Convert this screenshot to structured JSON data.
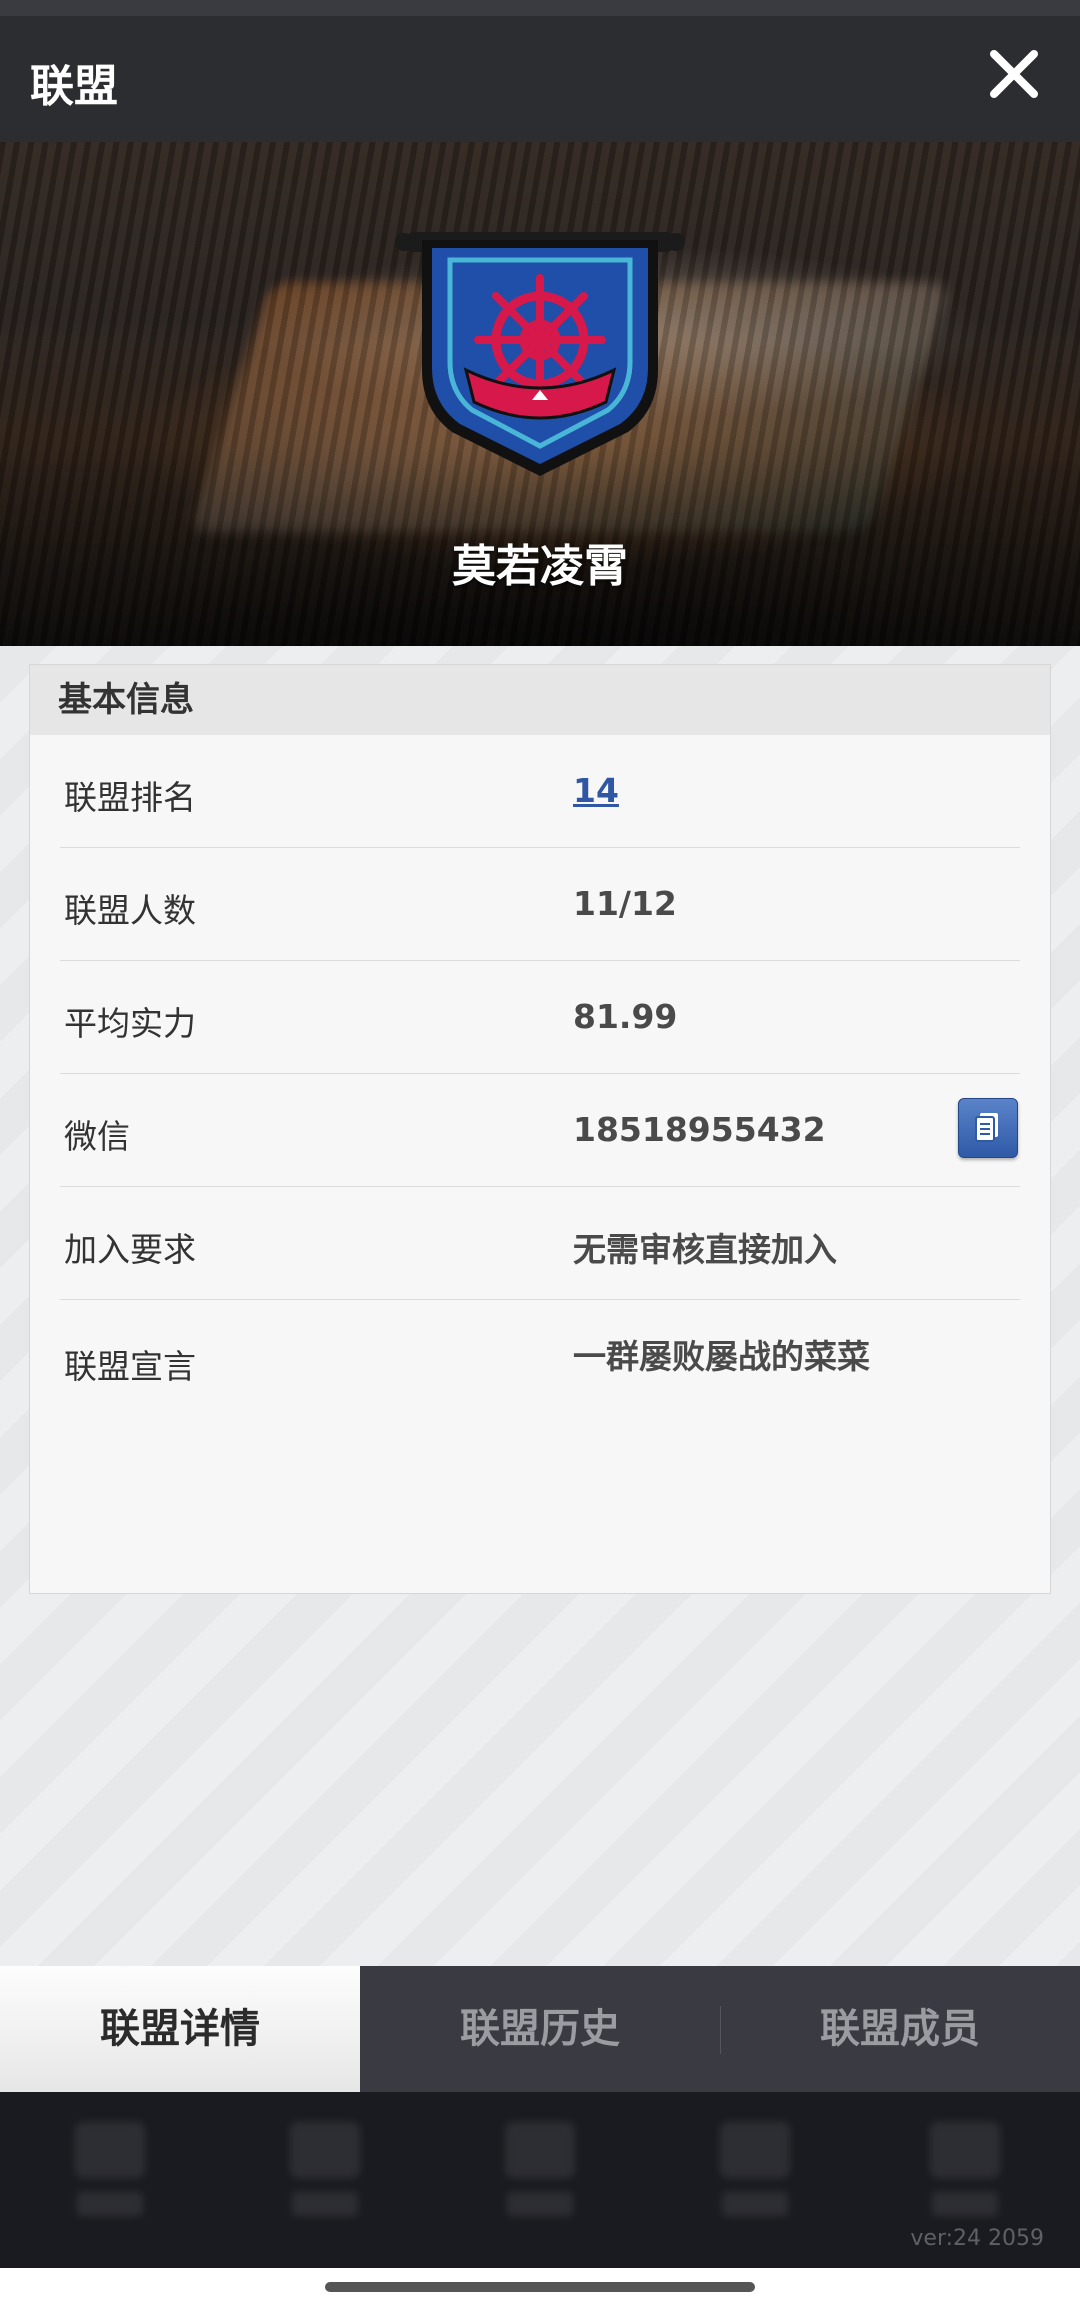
{
  "header": {
    "title": "联盟",
    "close_icon": "close-icon"
  },
  "hero": {
    "alliance_name": "莫若凌霄",
    "logo_icon": "ship-wheel-banner-emblem"
  },
  "info_card": {
    "title": "基本信息",
    "rows": [
      {
        "label": "联盟排名",
        "value": "14"
      },
      {
        "label": "联盟人数",
        "value": "11/12"
      },
      {
        "label": "平均实力",
        "value": "81.99"
      },
      {
        "label": "微信",
        "value": "18518955432"
      },
      {
        "label": "加入要求",
        "value": "无需审核直接加入"
      },
      {
        "label": "联盟宣言",
        "value": "一群屡败屡战的菜菜"
      }
    ]
  },
  "tabs": [
    {
      "label": "联盟详情",
      "active": true
    },
    {
      "label": "联盟历史",
      "active": false
    },
    {
      "label": "联盟成员",
      "active": false
    }
  ],
  "footer": {
    "version": "ver:24  2059"
  },
  "colors": {
    "link": "#2f57a4",
    "copy_button": "#3d66b0",
    "emblem_red": "#d6184a",
    "emblem_blue": "#1f4fa8"
  }
}
